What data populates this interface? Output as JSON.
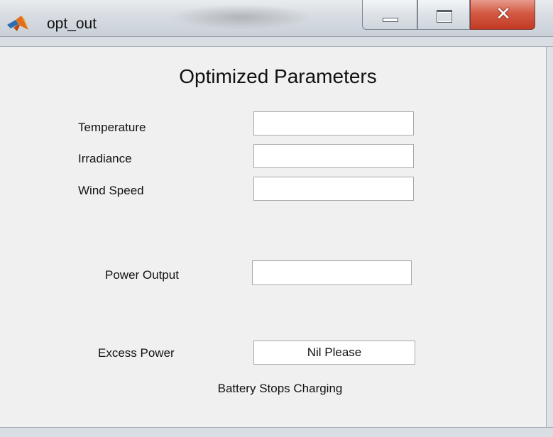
{
  "window": {
    "title": "opt_out",
    "icon": "matlab-icon",
    "close_glyph": "✕"
  },
  "form": {
    "heading": "Optimized Parameters",
    "temperature_label": "Temperature",
    "temperature_value": "",
    "irradiance_label": "Irradiance",
    "irradiance_value": "",
    "wind_speed_label": "Wind Speed",
    "wind_speed_value": "",
    "power_output_label": "Power Output",
    "power_output_value": "",
    "excess_power_label": "Excess Power",
    "excess_power_value": "Nil Please",
    "status_text": "Battery Stops Charging"
  }
}
